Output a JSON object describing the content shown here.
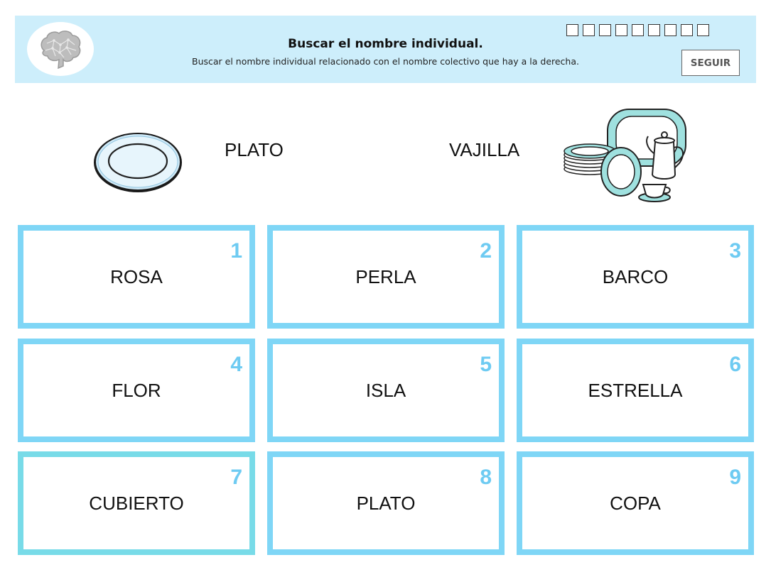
{
  "header": {
    "title": "Buscar el nombre individual.",
    "subtitle": "Buscar el nombre individual relacionado con el nombre colectivo que hay a la derecha.",
    "progress_boxes": 9,
    "next_label": "SEGUIR",
    "logo_icon": "brain-icon"
  },
  "prompt": {
    "individual_word": "PLATO",
    "collective_word": "VAJILLA",
    "individual_icon": "plate-icon",
    "collective_icon": "tableware-icon"
  },
  "options": [
    {
      "number": "1",
      "label": "ROSA"
    },
    {
      "number": "2",
      "label": "PERLA"
    },
    {
      "number": "3",
      "label": "BARCO"
    },
    {
      "number": "4",
      "label": "FLOR"
    },
    {
      "number": "5",
      "label": "ISLA"
    },
    {
      "number": "6",
      "label": "ESTRELLA"
    },
    {
      "number": "7",
      "label": "CUBIERTO"
    },
    {
      "number": "8",
      "label": "PLATO"
    },
    {
      "number": "9",
      "label": "COPA"
    }
  ],
  "colors": {
    "header_bg": "#cdeefb",
    "card_border": "#7fd6f6",
    "card_number": "#6ecbf2"
  }
}
